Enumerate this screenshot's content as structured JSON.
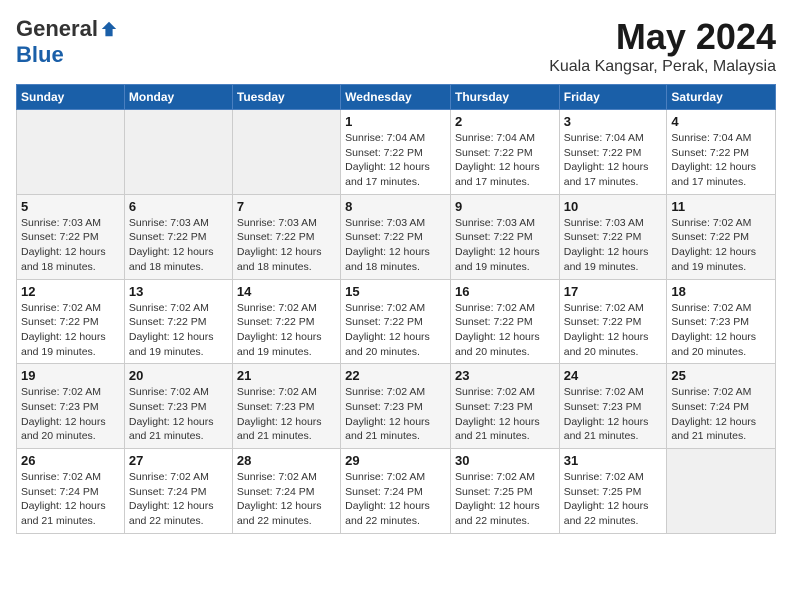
{
  "logo": {
    "general": "General",
    "blue": "Blue"
  },
  "title": "May 2024",
  "location": "Kuala Kangsar, Perak, Malaysia",
  "weekdays": [
    "Sunday",
    "Monday",
    "Tuesday",
    "Wednesday",
    "Thursday",
    "Friday",
    "Saturday"
  ],
  "weeks": [
    [
      {
        "day": "",
        "info": ""
      },
      {
        "day": "",
        "info": ""
      },
      {
        "day": "",
        "info": ""
      },
      {
        "day": "1",
        "info": "Sunrise: 7:04 AM\nSunset: 7:22 PM\nDaylight: 12 hours and 17 minutes."
      },
      {
        "day": "2",
        "info": "Sunrise: 7:04 AM\nSunset: 7:22 PM\nDaylight: 12 hours and 17 minutes."
      },
      {
        "day": "3",
        "info": "Sunrise: 7:04 AM\nSunset: 7:22 PM\nDaylight: 12 hours and 17 minutes."
      },
      {
        "day": "4",
        "info": "Sunrise: 7:04 AM\nSunset: 7:22 PM\nDaylight: 12 hours and 17 minutes."
      }
    ],
    [
      {
        "day": "5",
        "info": "Sunrise: 7:03 AM\nSunset: 7:22 PM\nDaylight: 12 hours and 18 minutes."
      },
      {
        "day": "6",
        "info": "Sunrise: 7:03 AM\nSunset: 7:22 PM\nDaylight: 12 hours and 18 minutes."
      },
      {
        "day": "7",
        "info": "Sunrise: 7:03 AM\nSunset: 7:22 PM\nDaylight: 12 hours and 18 minutes."
      },
      {
        "day": "8",
        "info": "Sunrise: 7:03 AM\nSunset: 7:22 PM\nDaylight: 12 hours and 18 minutes."
      },
      {
        "day": "9",
        "info": "Sunrise: 7:03 AM\nSunset: 7:22 PM\nDaylight: 12 hours and 19 minutes."
      },
      {
        "day": "10",
        "info": "Sunrise: 7:03 AM\nSunset: 7:22 PM\nDaylight: 12 hours and 19 minutes."
      },
      {
        "day": "11",
        "info": "Sunrise: 7:02 AM\nSunset: 7:22 PM\nDaylight: 12 hours and 19 minutes."
      }
    ],
    [
      {
        "day": "12",
        "info": "Sunrise: 7:02 AM\nSunset: 7:22 PM\nDaylight: 12 hours and 19 minutes."
      },
      {
        "day": "13",
        "info": "Sunrise: 7:02 AM\nSunset: 7:22 PM\nDaylight: 12 hours and 19 minutes."
      },
      {
        "day": "14",
        "info": "Sunrise: 7:02 AM\nSunset: 7:22 PM\nDaylight: 12 hours and 19 minutes."
      },
      {
        "day": "15",
        "info": "Sunrise: 7:02 AM\nSunset: 7:22 PM\nDaylight: 12 hours and 20 minutes."
      },
      {
        "day": "16",
        "info": "Sunrise: 7:02 AM\nSunset: 7:22 PM\nDaylight: 12 hours and 20 minutes."
      },
      {
        "day": "17",
        "info": "Sunrise: 7:02 AM\nSunset: 7:22 PM\nDaylight: 12 hours and 20 minutes."
      },
      {
        "day": "18",
        "info": "Sunrise: 7:02 AM\nSunset: 7:23 PM\nDaylight: 12 hours and 20 minutes."
      }
    ],
    [
      {
        "day": "19",
        "info": "Sunrise: 7:02 AM\nSunset: 7:23 PM\nDaylight: 12 hours and 20 minutes."
      },
      {
        "day": "20",
        "info": "Sunrise: 7:02 AM\nSunset: 7:23 PM\nDaylight: 12 hours and 21 minutes."
      },
      {
        "day": "21",
        "info": "Sunrise: 7:02 AM\nSunset: 7:23 PM\nDaylight: 12 hours and 21 minutes."
      },
      {
        "day": "22",
        "info": "Sunrise: 7:02 AM\nSunset: 7:23 PM\nDaylight: 12 hours and 21 minutes."
      },
      {
        "day": "23",
        "info": "Sunrise: 7:02 AM\nSunset: 7:23 PM\nDaylight: 12 hours and 21 minutes."
      },
      {
        "day": "24",
        "info": "Sunrise: 7:02 AM\nSunset: 7:23 PM\nDaylight: 12 hours and 21 minutes."
      },
      {
        "day": "25",
        "info": "Sunrise: 7:02 AM\nSunset: 7:24 PM\nDaylight: 12 hours and 21 minutes."
      }
    ],
    [
      {
        "day": "26",
        "info": "Sunrise: 7:02 AM\nSunset: 7:24 PM\nDaylight: 12 hours and 21 minutes."
      },
      {
        "day": "27",
        "info": "Sunrise: 7:02 AM\nSunset: 7:24 PM\nDaylight: 12 hours and 22 minutes."
      },
      {
        "day": "28",
        "info": "Sunrise: 7:02 AM\nSunset: 7:24 PM\nDaylight: 12 hours and 22 minutes."
      },
      {
        "day": "29",
        "info": "Sunrise: 7:02 AM\nSunset: 7:24 PM\nDaylight: 12 hours and 22 minutes."
      },
      {
        "day": "30",
        "info": "Sunrise: 7:02 AM\nSunset: 7:25 PM\nDaylight: 12 hours and 22 minutes."
      },
      {
        "day": "31",
        "info": "Sunrise: 7:02 AM\nSunset: 7:25 PM\nDaylight: 12 hours and 22 minutes."
      },
      {
        "day": "",
        "info": ""
      }
    ]
  ]
}
